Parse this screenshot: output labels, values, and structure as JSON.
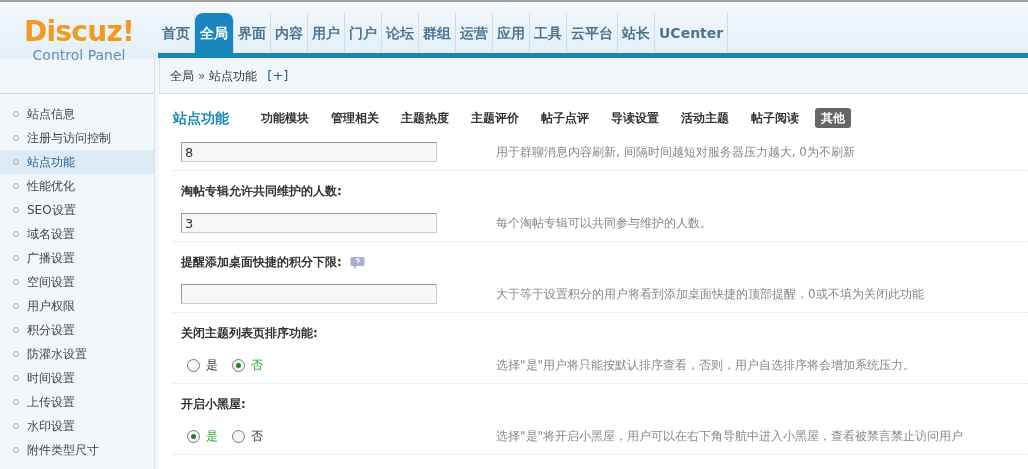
{
  "logo": {
    "brand": "Discuz!",
    "subtitle": "Control Panel"
  },
  "nav": [
    {
      "label": "首页",
      "selected": false
    },
    {
      "label": "全局",
      "selected": true
    },
    {
      "label": "界面",
      "selected": false
    },
    {
      "label": "内容",
      "selected": false
    },
    {
      "label": "用户",
      "selected": false
    },
    {
      "label": "门户",
      "selected": false
    },
    {
      "label": "论坛",
      "selected": false
    },
    {
      "label": "群组",
      "selected": false
    },
    {
      "label": "运营",
      "selected": false
    },
    {
      "label": "应用",
      "selected": false
    },
    {
      "label": "工具",
      "selected": false
    },
    {
      "label": "云平台",
      "selected": false
    },
    {
      "label": "站长",
      "selected": false
    },
    {
      "label": "UCenter",
      "selected": false
    }
  ],
  "breadcrumb": {
    "parent": "全局",
    "separator": "»",
    "current": "站点功能",
    "add": "[+]"
  },
  "sidebar": {
    "items": [
      {
        "label": "站点信息",
        "selected": false
      },
      {
        "label": "注册与访问控制",
        "selected": false
      },
      {
        "label": "站点功能",
        "selected": true
      },
      {
        "label": "性能优化",
        "selected": false
      },
      {
        "label": "SEO设置",
        "selected": false
      },
      {
        "label": "域名设置",
        "selected": false
      },
      {
        "label": "广播设置",
        "selected": false
      },
      {
        "label": "空间设置",
        "selected": false
      },
      {
        "label": "用户权限",
        "selected": false
      },
      {
        "label": "积分设置",
        "selected": false
      },
      {
        "label": "防灌水设置",
        "selected": false
      },
      {
        "label": "时间设置",
        "selected": false
      },
      {
        "label": "上传设置",
        "selected": false
      },
      {
        "label": "水印设置",
        "selected": false
      },
      {
        "label": "附件类型尺寸",
        "selected": false
      }
    ]
  },
  "page_title": "站点功能",
  "tabs": [
    {
      "label": "功能模块",
      "selected": false
    },
    {
      "label": "管理相关",
      "selected": false
    },
    {
      "label": "主题热度",
      "selected": false
    },
    {
      "label": "主题评价",
      "selected": false
    },
    {
      "label": "帖子点评",
      "selected": false
    },
    {
      "label": "导读设置",
      "selected": false
    },
    {
      "label": "活动主题",
      "selected": false
    },
    {
      "label": "帖子阅读",
      "selected": false
    },
    {
      "label": "其他",
      "selected": true
    }
  ],
  "settings": [
    {
      "kind": "text",
      "value": "8",
      "description": "用于群聊消息内容刷新, 间隔时间越短对服务器压力越大, 0为不刷新"
    },
    {
      "title": "淘帖专辑允许共同维护的人数:",
      "kind": "text",
      "value": "3",
      "description": "每个淘帖专辑可以共同参与维护的人数。"
    },
    {
      "title": "提醒添加桌面快捷的积分下限:",
      "help": true,
      "kind": "text",
      "description": "大于等于设置积分的用户将看到添加桌面快捷的顶部提醒，0或不填为关闭此功能"
    },
    {
      "title": "关闭主题列表页排序功能:",
      "kind": "radio",
      "options": [
        {
          "label": "是",
          "selected": false
        },
        {
          "label": "否",
          "selected": true
        }
      ],
      "description": "选择\"是\"用户将只能按默认排序查看，否则，用户自选排序将会增加系统压力。"
    },
    {
      "title": "开启小黑屋:",
      "kind": "radio",
      "options": [
        {
          "label": "是",
          "selected": true
        },
        {
          "label": "否",
          "selected": false
        }
      ],
      "description": "选择\"是\"将开启小黑屋，用户可以在右下角导航中进入小黑屋，查看被禁言禁止访问用户"
    }
  ]
}
